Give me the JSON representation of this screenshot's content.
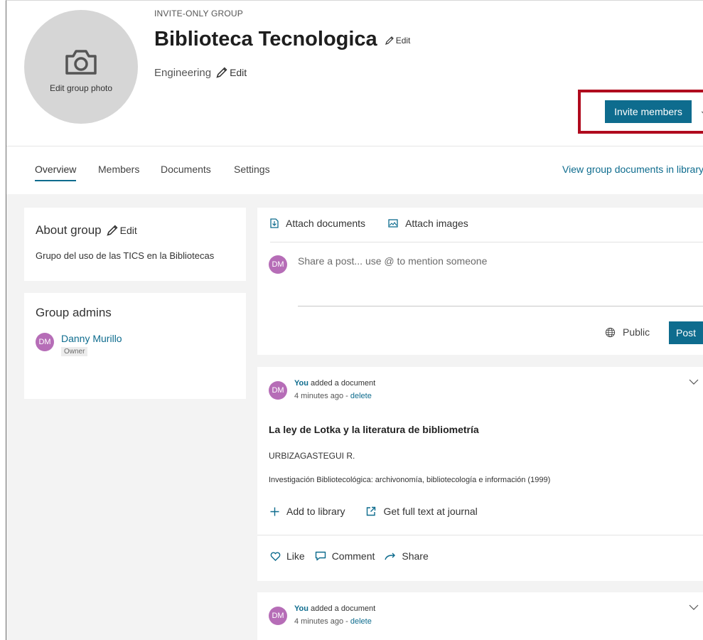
{
  "header": {
    "photo_label": "Edit group photo",
    "group_type": "INVITE-ONLY GROUP",
    "title": "Biblioteca Tecnologica",
    "title_edit": "Edit",
    "subject": "Engineering",
    "subject_edit": "Edit",
    "invite_button": "Invite members",
    "highlight_color": "#b00b1e"
  },
  "tabs": {
    "items": [
      "Overview",
      "Members",
      "Documents",
      "Settings"
    ],
    "active": "Overview",
    "library_link": "View group documents in library"
  },
  "about": {
    "title": "About group",
    "edit": "Edit",
    "description": "Grupo del uso de las TICS en la Bibliotecas"
  },
  "admins": {
    "title": "Group admins",
    "items": [
      {
        "initials": "DM",
        "name": "Danny Murillo",
        "role": "Owner"
      }
    ]
  },
  "composer": {
    "attach_documents": "Attach documents",
    "attach_images": "Attach images",
    "avatar_initials": "DM",
    "placeholder": "Share a post... use @ to mention someone",
    "visibility": "Public",
    "post_button": "Post"
  },
  "feed": [
    {
      "initials": "DM",
      "actor": "You",
      "action": " added a document",
      "time": "4 minutes ago - ",
      "delete_label": "delete",
      "doc_title": "La ley de Lotka y la literatura de bibliometría",
      "doc_author": "URBIZAGASTEGUI R.",
      "doc_source": "Investigación Bibliotecológica: archivonomía, bibliotecología e información (1999)",
      "add_to_library": "Add to library",
      "full_text": "Get full text at journal",
      "like": "Like",
      "comment": "Comment",
      "share": "Share"
    },
    {
      "initials": "DM",
      "actor": "You",
      "action": " added a document",
      "time": "4 minutes ago - ",
      "delete_label": "delete"
    }
  ],
  "colors": {
    "accent": "#0e6c8e",
    "avatar": "#b66db7",
    "background": "#f3f3f3"
  }
}
